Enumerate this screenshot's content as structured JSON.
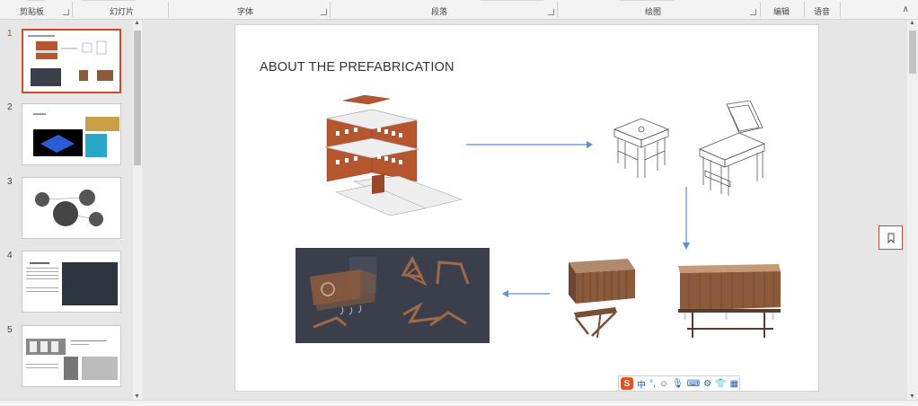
{
  "ribbon": {
    "groups": [
      "剪贴板",
      "幻灯片",
      "字体",
      "段落",
      "绘图",
      "编辑",
      "语音"
    ]
  },
  "thumbnails": [
    {
      "number": "1",
      "active": true
    },
    {
      "number": "2",
      "active": false
    },
    {
      "number": "3",
      "active": false
    },
    {
      "number": "4",
      "active": false
    },
    {
      "number": "5",
      "active": false
    }
  ],
  "slide": {
    "title": "ABOUT THE PREFABRICATION"
  },
  "ime": {
    "mode_label": "中"
  },
  "colors": {
    "accent": "#d24726",
    "arrow": "#5b8fd4",
    "brick": "#b5562f",
    "dark_render": "#3b3f4c",
    "wood": "#8b5a3c"
  }
}
